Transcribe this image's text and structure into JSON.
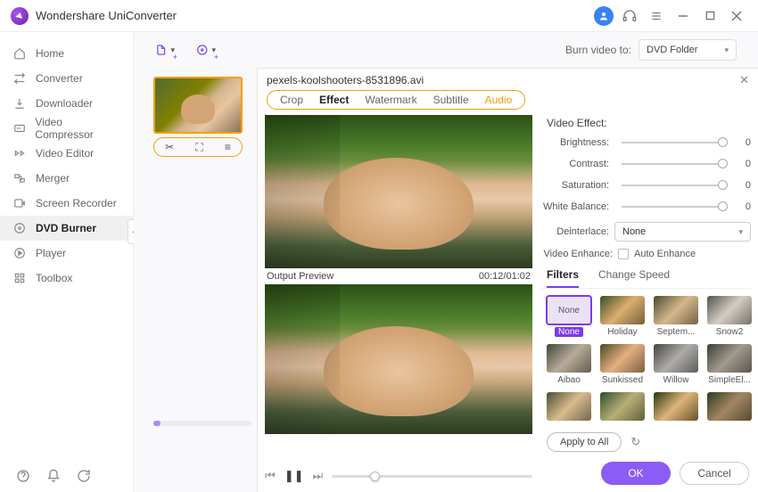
{
  "app": {
    "title": "Wondershare UniConverter"
  },
  "sidebar": {
    "items": [
      {
        "label": "Home"
      },
      {
        "label": "Converter"
      },
      {
        "label": "Downloader"
      },
      {
        "label": "Video Compressor"
      },
      {
        "label": "Video Editor"
      },
      {
        "label": "Merger"
      },
      {
        "label": "Screen Recorder"
      },
      {
        "label": "DVD Burner"
      },
      {
        "label": "Player"
      },
      {
        "label": "Toolbox"
      }
    ],
    "active_index": 7
  },
  "toolbar": {
    "burn_label": "Burn video to:",
    "burn_target": "DVD Folder"
  },
  "dialog": {
    "filename": "pexels-koolshooters-8531896.avi",
    "tabs": [
      "Crop",
      "Effect",
      "Watermark",
      "Subtitle",
      "Audio"
    ],
    "active_tab": "Effect",
    "preview_label": "Output Preview",
    "timestamp": "00:12/01:02",
    "ok": "OK",
    "cancel": "Cancel"
  },
  "effect": {
    "section": "Video Effect:",
    "sliders": {
      "brightness": {
        "label": "Brightness:",
        "value": 0
      },
      "contrast": {
        "label": "Contrast:",
        "value": 0
      },
      "saturation": {
        "label": "Saturation:",
        "value": 0
      },
      "white_balance": {
        "label": "White Balance:",
        "value": 0
      }
    },
    "deinterlace": {
      "label": "Deinterlace:",
      "value": "None"
    },
    "enhance": {
      "label": "Video Enhance:",
      "checkbox_label": "Auto Enhance",
      "checked": false
    },
    "sub_tabs": [
      "Filters",
      "Change Speed"
    ],
    "active_sub_tab": "Filters",
    "filters": [
      {
        "name": "None",
        "selected": true
      },
      {
        "name": "Holiday"
      },
      {
        "name": "Septem..."
      },
      {
        "name": "Snow2"
      },
      {
        "name": "Aibao"
      },
      {
        "name": "Sunkissed"
      },
      {
        "name": "Willow"
      },
      {
        "name": "SimpleEl..."
      },
      {
        "name": ""
      },
      {
        "name": ""
      },
      {
        "name": ""
      },
      {
        "name": ""
      }
    ],
    "apply_all": "Apply to All"
  }
}
